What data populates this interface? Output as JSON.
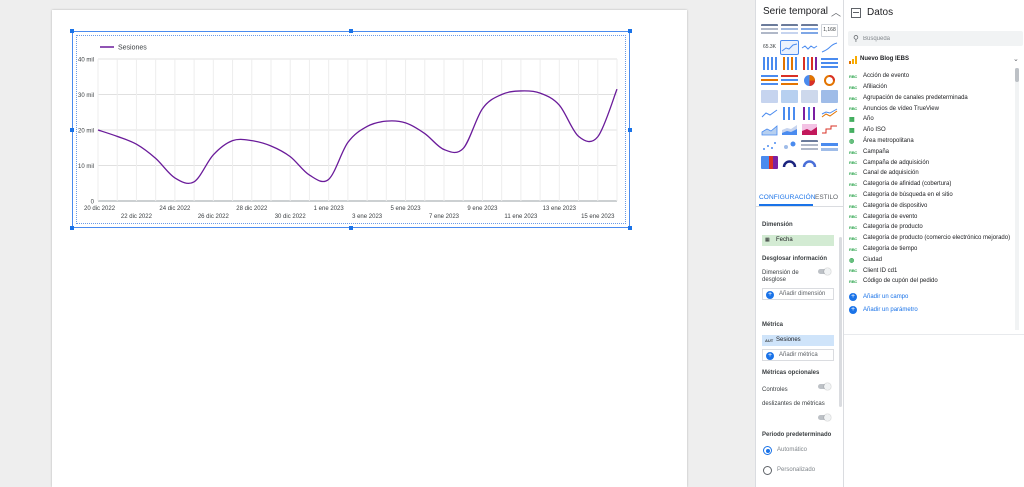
{
  "chart_data": {
    "type": "line",
    "title": "",
    "xlabel": "",
    "ylabel": "",
    "legend": "top-left",
    "grid": true,
    "ylim": [
      0,
      40
    ],
    "yticks": [
      "0",
      "10 mil",
      "20 mil",
      "30 mil",
      "40 mil"
    ],
    "ytick_values": [
      0,
      10000,
      20000,
      30000,
      40000
    ],
    "x": [
      "20 dic 2022",
      "21 dic 2022",
      "22 dic 2022",
      "23 dic 2022",
      "24 dic 2022",
      "25 dic 2022",
      "26 dic 2022",
      "27 dic 2022",
      "28 dic 2022",
      "29 dic 2022",
      "30 dic 2022",
      "31 dic 2022",
      "1 ene 2023",
      "2 ene 2023",
      "3 ene 2023",
      "4 ene 2023",
      "5 ene 2023",
      "6 ene 2023",
      "7 ene 2023",
      "8 ene 2023",
      "9 ene 2023",
      "10 ene 2023",
      "11 ene 2023",
      "12 ene 2023",
      "13 ene 2023",
      "14 ene 2023",
      "15 ene 2023",
      "16 ene 2023"
    ],
    "xtick_labels": [
      "20 dic 2022",
      "22 dic 2022",
      "24 dic 2022",
      "26 dic 2022",
      "28 dic 2022",
      "30 dic 2022",
      "1 ene 2023",
      "3 ene 2023",
      "5 ene 2023",
      "7 ene 2023",
      "9 ene 2023",
      "11 ene 2023",
      "13 ene 2023",
      "15 ene 2023"
    ],
    "series": [
      {
        "name": "Sesiones",
        "color": "#6a1b9a",
        "values": [
          20000,
          18200,
          16000,
          12000,
          6500,
          5400,
          13000,
          17000,
          17000,
          15500,
          12500,
          7300,
          6100,
          16500,
          21000,
          22500,
          22000,
          19000,
          14500,
          14800,
          26000,
          30000,
          31000,
          30400,
          27000,
          18200,
          18100,
          31500
        ]
      }
    ]
  },
  "properties_panel": {
    "title": "Serie temporal",
    "tab_config": "CONFIGURACIÓN",
    "tab_style": "ESTILO",
    "dimension_label": "Dimensión",
    "dimension_chip": "Fecha",
    "dimension_chip_icon": "calendar-icon",
    "breakdown_title": "Desglosar información",
    "breakdown_dimension_label": "Dimensión de desglose",
    "add_dimension": "Añadir dimensión",
    "metric_label": "Métrica",
    "metric_chip": "Sesiones",
    "metric_chip_icon": "AUT",
    "add_metric": "Añadir métrica",
    "optional_metrics": "Métricas opcionales",
    "controls_label": "Controles",
    "metric_sliders": "deslizantes de métricas",
    "default_period": "Periodo predeterminado",
    "radio_auto": "Automático",
    "radio_custom": "Personalizado"
  },
  "data_panel": {
    "title": "Datos",
    "search_placeholder": "Búsqueda",
    "source_name": "Nuevo Blog IEBS",
    "fields": [
      {
        "icon": "RBC",
        "name": "Acción de evento"
      },
      {
        "icon": "RBC",
        "name": "Afiliación"
      },
      {
        "icon": "RBC",
        "name": "Agrupación de canales predeterminada"
      },
      {
        "icon": "RBC",
        "name": "Anuncios de vídeo TrueView"
      },
      {
        "icon": "cal",
        "name": "Año"
      },
      {
        "icon": "cal",
        "name": "Año ISO"
      },
      {
        "icon": "geo",
        "name": "Área metropolitana"
      },
      {
        "icon": "RBC",
        "name": "Campaña"
      },
      {
        "icon": "RBC",
        "name": "Campaña de adquisición"
      },
      {
        "icon": "RBC",
        "name": "Canal de adquisición"
      },
      {
        "icon": "RBC",
        "name": "Categoría de afinidad (cobertura)"
      },
      {
        "icon": "RBC",
        "name": "Categoría de búsqueda en el sitio"
      },
      {
        "icon": "RBC",
        "name": "Categoría de dispositivo"
      },
      {
        "icon": "RBC",
        "name": "Categoría de evento"
      },
      {
        "icon": "RBC",
        "name": "Categoría de producto"
      },
      {
        "icon": "RBC",
        "name": "Categoría de producto (comercio electrónico mejorado)"
      },
      {
        "icon": "RBC",
        "name": "Categoría de tiempo"
      },
      {
        "icon": "geo",
        "name": "Ciudad"
      },
      {
        "icon": "RBC",
        "name": "Client ID cd1"
      },
      {
        "icon": "RBC",
        "name": "Código de cupón del pedido"
      }
    ],
    "add_field": "Añadir un campo",
    "add_parameter": "Añadir un parámetro"
  }
}
